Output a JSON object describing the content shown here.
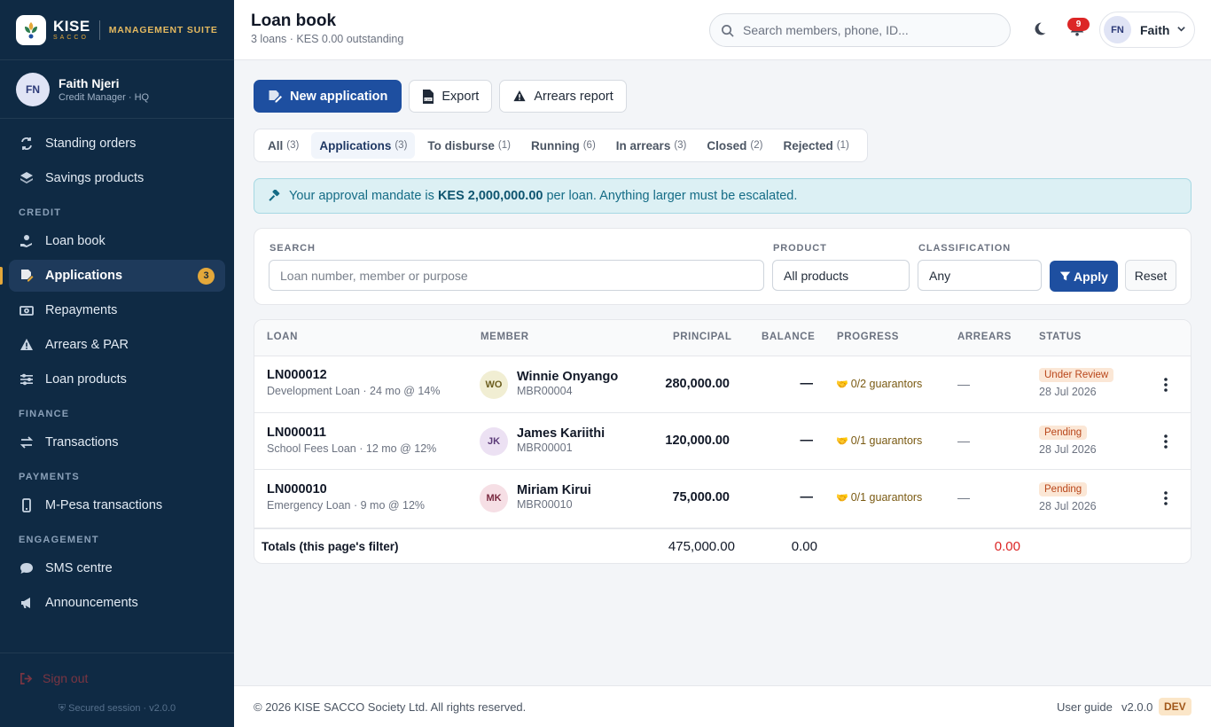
{
  "brand": {
    "name": "KISE",
    "sub": "SACCO",
    "suite": "MANAGEMENT SUITE"
  },
  "user": {
    "initials": "FN",
    "name": "Faith Njeri",
    "role": "Credit Manager · HQ",
    "first_name": "Faith"
  },
  "sidebar": {
    "top_items": [
      {
        "label": "Standing orders",
        "icon": "repeat-icon"
      },
      {
        "label": "Savings products",
        "icon": "layers-icon"
      }
    ],
    "sections": [
      {
        "title": "CREDIT",
        "items": [
          {
            "label": "Loan book",
            "icon": "hand-coin-icon"
          },
          {
            "label": "Applications",
            "icon": "file-signature-icon",
            "badge": "3",
            "active": true
          },
          {
            "label": "Repayments",
            "icon": "money-bill-icon"
          },
          {
            "label": "Arrears & PAR",
            "icon": "warning-icon"
          },
          {
            "label": "Loan products",
            "icon": "sliders-icon"
          }
        ]
      },
      {
        "title": "FINANCE",
        "items": [
          {
            "label": "Transactions",
            "icon": "exchange-icon"
          }
        ]
      },
      {
        "title": "PAYMENTS",
        "items": [
          {
            "label": "M-Pesa transactions",
            "icon": "mobile-icon"
          }
        ]
      },
      {
        "title": "ENGAGEMENT",
        "items": [
          {
            "label": "SMS centre",
            "icon": "sms-icon"
          },
          {
            "label": "Announcements",
            "icon": "megaphone-icon"
          }
        ]
      }
    ],
    "sign_out": "Sign out",
    "secured": "Secured session · v2.0.0"
  },
  "header": {
    "title": "Loan book",
    "subtitle": "3 loans · KES 0.00 outstanding",
    "search_placeholder": "Search members, phone, ID...",
    "notifications": "9"
  },
  "actions": {
    "new_application": "New application",
    "export": "Export",
    "arrears_report": "Arrears report"
  },
  "tabs": [
    {
      "label": "All",
      "count": "(3)"
    },
    {
      "label": "Applications",
      "count": "(3)",
      "active": true
    },
    {
      "label": "To disburse",
      "count": "(1)"
    },
    {
      "label": "Running",
      "count": "(6)"
    },
    {
      "label": "In arrears",
      "count": "(3)"
    },
    {
      "label": "Closed",
      "count": "(2)"
    },
    {
      "label": "Rejected",
      "count": "(1)"
    }
  ],
  "alert": {
    "prefix": "Your approval mandate is",
    "amount": "KES 2,000,000.00",
    "suffix": "per loan. Anything larger must be escalated."
  },
  "filter": {
    "search_label": "SEARCH",
    "search_placeholder": "Loan number, member or purpose",
    "product_label": "PRODUCT",
    "product_value": "All products",
    "class_label": "CLASSIFICATION",
    "class_value": "Any",
    "apply": "Apply",
    "reset": "Reset"
  },
  "table": {
    "headers": {
      "loan": "LOAN",
      "member": "MEMBER",
      "principal": "PRINCIPAL",
      "balance": "BALANCE",
      "progress": "PROGRESS",
      "arrears": "ARREARS",
      "status": "STATUS"
    },
    "rows": [
      {
        "loan_no": "LN000012",
        "desc": "Development Loan · 24 mo @ 14%",
        "initials": "WO",
        "member": "Winnie Onyango",
        "member_no": "MBR00004",
        "principal": "280,000.00",
        "balance": "—",
        "progress": "0/2 guarantors",
        "arrears": "—",
        "status": "Under Review",
        "date": "28 Jul 2026",
        "avatar_bg": "#f1eed3",
        "avatar_fg": "#6b5d1e"
      },
      {
        "loan_no": "LN000011",
        "desc": "School Fees Loan · 12 mo @ 12%",
        "initials": "JK",
        "member": "James Kariithi",
        "member_no": "MBR00001",
        "principal": "120,000.00",
        "balance": "—",
        "progress": "0/1 guarantors",
        "arrears": "—",
        "status": "Pending",
        "date": "28 Jul 2026",
        "avatar_bg": "#ece1f3",
        "avatar_fg": "#5b3a78"
      },
      {
        "loan_no": "LN000010",
        "desc": "Emergency Loan · 9 mo @ 12%",
        "initials": "MK",
        "member": "Miriam Kirui",
        "member_no": "MBR00010",
        "principal": "75,000.00",
        "balance": "—",
        "progress": "0/1 guarantors",
        "arrears": "—",
        "status": "Pending",
        "date": "28 Jul 2026",
        "avatar_bg": "#f6dfe5",
        "avatar_fg": "#7a2940"
      }
    ],
    "totals": {
      "label": "Totals (this page's filter)",
      "principal": "475,000.00",
      "balance": "0.00",
      "arrears": "0.00"
    }
  },
  "footer": {
    "copyright": "© 2026 KISE SACCO Society Ltd. All rights reserved.",
    "guide": "User guide",
    "version": "v2.0.0",
    "env": "DEV"
  },
  "colors": {
    "primary": "#1e4fa0",
    "sidebar": "#0f2a44",
    "accent": "#e4a83a",
    "danger": "#dc2626"
  }
}
